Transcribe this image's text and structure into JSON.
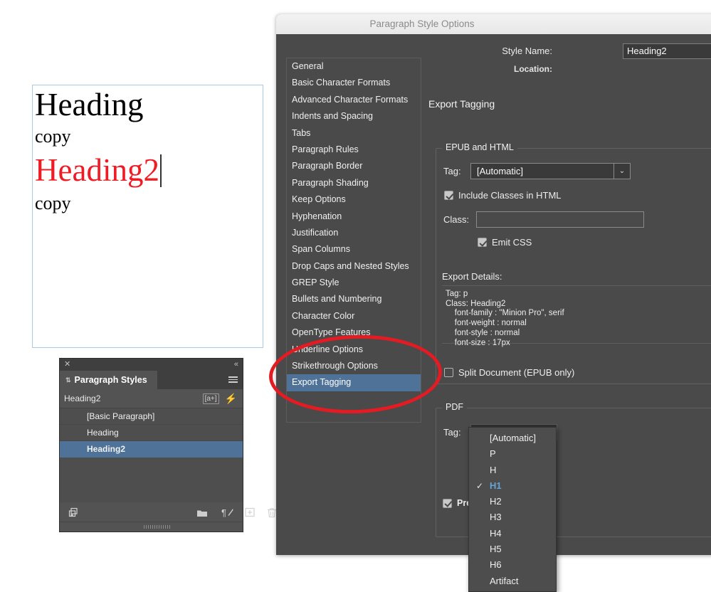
{
  "document": {
    "lines": [
      {
        "text": "Heading",
        "style": "h1"
      },
      {
        "text": "copy",
        "style": "copy"
      },
      {
        "text": "Heading2",
        "style": "h2"
      },
      {
        "text": "copy",
        "style": "copy"
      }
    ],
    "heading2_color": "#ee1c25"
  },
  "paragraph_styles_panel": {
    "close_icon": "✕",
    "collapse_icon": "«",
    "tab_label": "Paragraph Styles",
    "tab_arrows_icon": "⇅",
    "menu_icon": "hamburger-icon",
    "current_style": "Heading2",
    "mini_badge": "[a+]",
    "bolt_icon": "⚡",
    "styles": [
      {
        "name": "[Basic Paragraph]",
        "selected": false
      },
      {
        "name": "Heading",
        "selected": false
      },
      {
        "name": "Heading2",
        "selected": true
      }
    ],
    "footer_icons": [
      "load-styles-icon",
      "new-style-group-icon",
      "clear-overrides-icon",
      "new-style-icon",
      "delete-style-icon"
    ],
    "selected_color": "#4e7298"
  },
  "dialog": {
    "title": "Paragraph Style Options",
    "style_name_label": "Style Name:",
    "style_name_value": "Heading2",
    "location_label": "Location:",
    "preview_label": "Preview",
    "preview_checked": true,
    "nav_items": [
      {
        "label": "General",
        "selected": false
      },
      {
        "label": "Basic Character Formats",
        "selected": false
      },
      {
        "label": "Advanced Character Formats",
        "selected": false
      },
      {
        "label": "Indents and Spacing",
        "selected": false
      },
      {
        "label": "Tabs",
        "selected": false
      },
      {
        "label": "Paragraph Rules",
        "selected": false
      },
      {
        "label": "Paragraph Border",
        "selected": false
      },
      {
        "label": "Paragraph Shading",
        "selected": false
      },
      {
        "label": "Keep Options",
        "selected": false
      },
      {
        "label": "Hyphenation",
        "selected": false
      },
      {
        "label": "Justification",
        "selected": false
      },
      {
        "label": "Span Columns",
        "selected": false
      },
      {
        "label": "Drop Caps and Nested Styles",
        "selected": false
      },
      {
        "label": "GREP Style",
        "selected": false
      },
      {
        "label": "Bullets and Numbering",
        "selected": false
      },
      {
        "label": "Character Color",
        "selected": false
      },
      {
        "label": "OpenType Features",
        "selected": false
      },
      {
        "label": "Underline Options",
        "selected": false
      },
      {
        "label": "Strikethrough Options",
        "selected": false
      },
      {
        "label": "Export Tagging",
        "selected": true
      }
    ],
    "pane": {
      "title": "Export Tagging",
      "epub": {
        "legend": "EPUB and HTML",
        "tag_label": "Tag:",
        "tag_value": "[Automatic]",
        "dropdown_arrow": "⌄",
        "include_classes_label": "Include Classes in HTML",
        "include_classes_checked": true,
        "class_label": "Class:",
        "class_value": "",
        "emit_css_label": "Emit CSS",
        "emit_css_checked": true,
        "export_details_label": "Export Details:",
        "export_details_text": "Tag: p\nClass: Heading2\n    font-family : \"Minion Pro\", serif\n    font-weight : normal\n    font-style : normal\n    font-size : 17px",
        "split_document_label": "Split Document (EPUB only)",
        "split_document_checked": false
      },
      "pdf": {
        "legend": "PDF",
        "tag_label": "Tag:",
        "tag_value": "H1",
        "dropdown_arrow": "⌄",
        "options": [
          {
            "label": "[Automatic]",
            "selected": false
          },
          {
            "label": "P",
            "selected": false
          },
          {
            "label": "H",
            "selected": false
          },
          {
            "label": "H1",
            "selected": true
          },
          {
            "label": "H2",
            "selected": false
          },
          {
            "label": "H3",
            "selected": false
          },
          {
            "label": "H4",
            "selected": false
          },
          {
            "label": "H5",
            "selected": false
          },
          {
            "label": "H6",
            "selected": false
          },
          {
            "label": "Artifact",
            "selected": false
          }
        ],
        "selected_option_color": "#65a4d8"
      }
    }
  },
  "annotation": {
    "shape": "red-ellipse",
    "color": "#e31b23"
  }
}
